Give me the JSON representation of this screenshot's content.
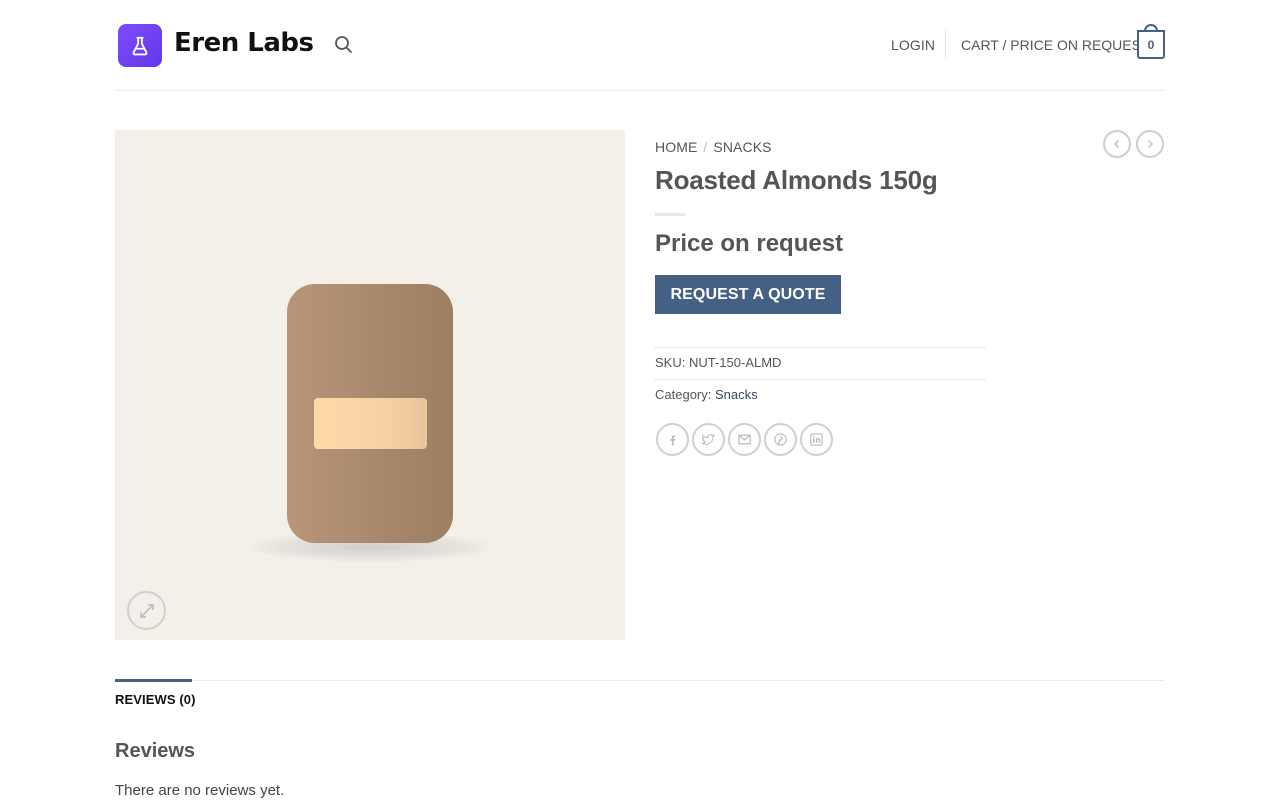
{
  "header": {
    "logo_text": "Eren Labs",
    "logo_icon": "flask-icon",
    "search_icon": "search-icon",
    "login_label": "LOGIN",
    "cart_label": "CART",
    "cart_sep": " / ",
    "cart_price_label": "PRICE ON REQUEST",
    "cart_count": "0",
    "brand_color": "#7c4dff"
  },
  "breadcrumb": {
    "home": "HOME",
    "separator": "/",
    "category": "SNACKS"
  },
  "product": {
    "title": "Roasted Almonds 150g",
    "price": "Price on request",
    "button_label": "REQUEST A QUOTE",
    "sku_label": "SKU:",
    "sku_value": "NUT-150-ALMD",
    "category_label": "Category:",
    "category_value": "Snacks",
    "accent_color": "#446084"
  },
  "share_icons": [
    "facebook-icon",
    "twitter-icon",
    "email-icon",
    "pinterest-icon",
    "linkedin-icon"
  ],
  "tabs": {
    "reviews_tab": "REVIEWS (0)"
  },
  "reviews": {
    "heading": "Reviews",
    "empty_text": "There are no reviews yet."
  }
}
